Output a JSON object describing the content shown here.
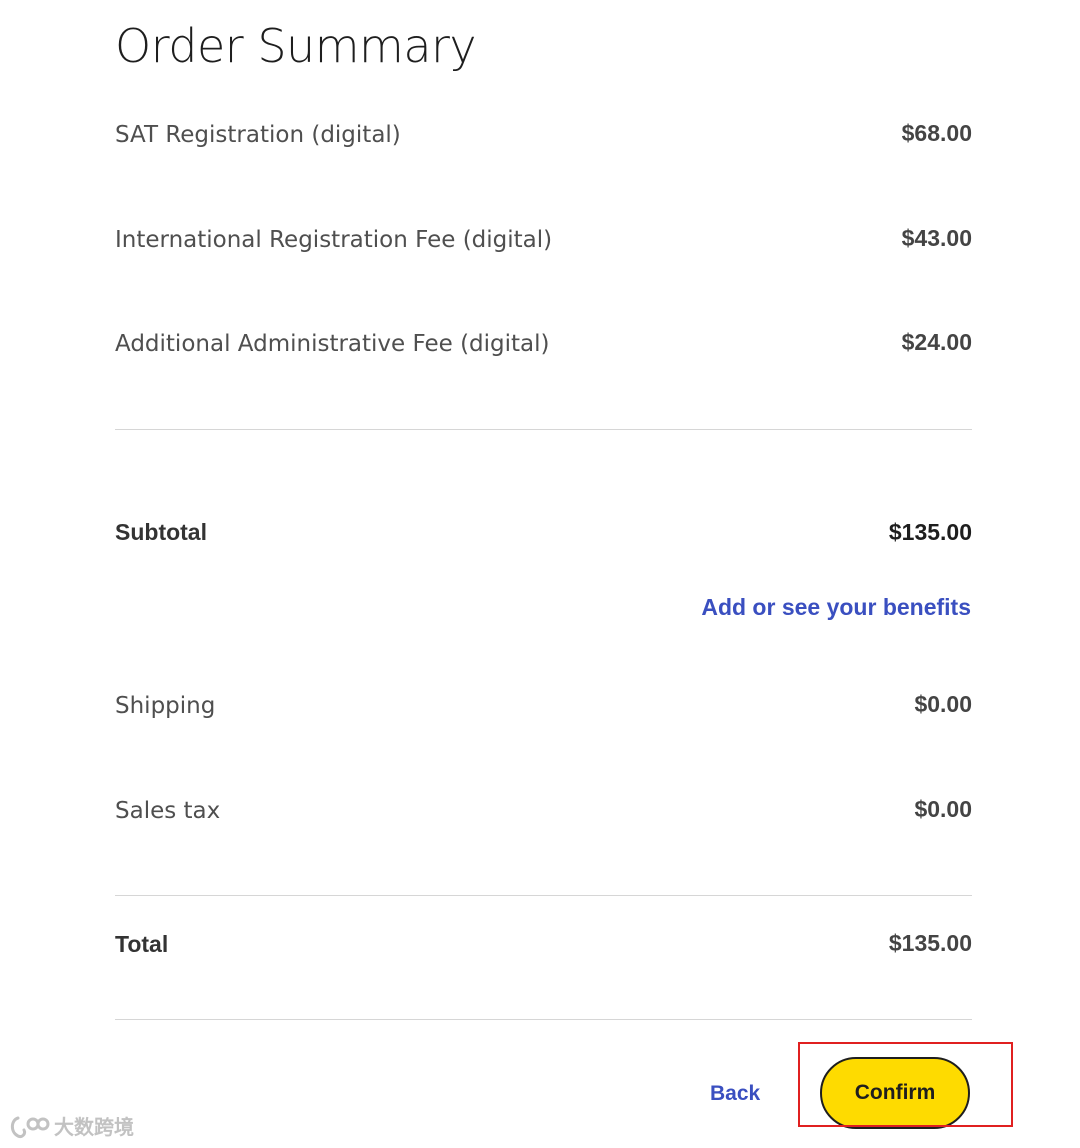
{
  "page": {
    "title": "Order Summary"
  },
  "line_items": [
    {
      "label": "SAT Registration (digital)",
      "amount": "$68.00"
    },
    {
      "label": "International Registration Fee (digital)",
      "amount": "$43.00"
    },
    {
      "label": "Additional Administrative Fee (digital)",
      "amount": "$24.00"
    }
  ],
  "subtotal": {
    "label": "Subtotal",
    "amount": "$135.00"
  },
  "benefits_link": "Add or see your benefits",
  "shipping": {
    "label": "Shipping",
    "amount": "$0.00"
  },
  "sales_tax": {
    "label": "Sales tax",
    "amount": "$0.00"
  },
  "total": {
    "label": "Total",
    "amount": "$135.00"
  },
  "actions": {
    "back_label": "Back",
    "confirm_label": "Confirm"
  },
  "watermark": {
    "text": "大数跨境",
    "icon": "watermark-logo-icon"
  },
  "colors": {
    "link": "#3a4fc0",
    "confirm_bg": "#fedb00",
    "highlight_border": "#e02020"
  }
}
